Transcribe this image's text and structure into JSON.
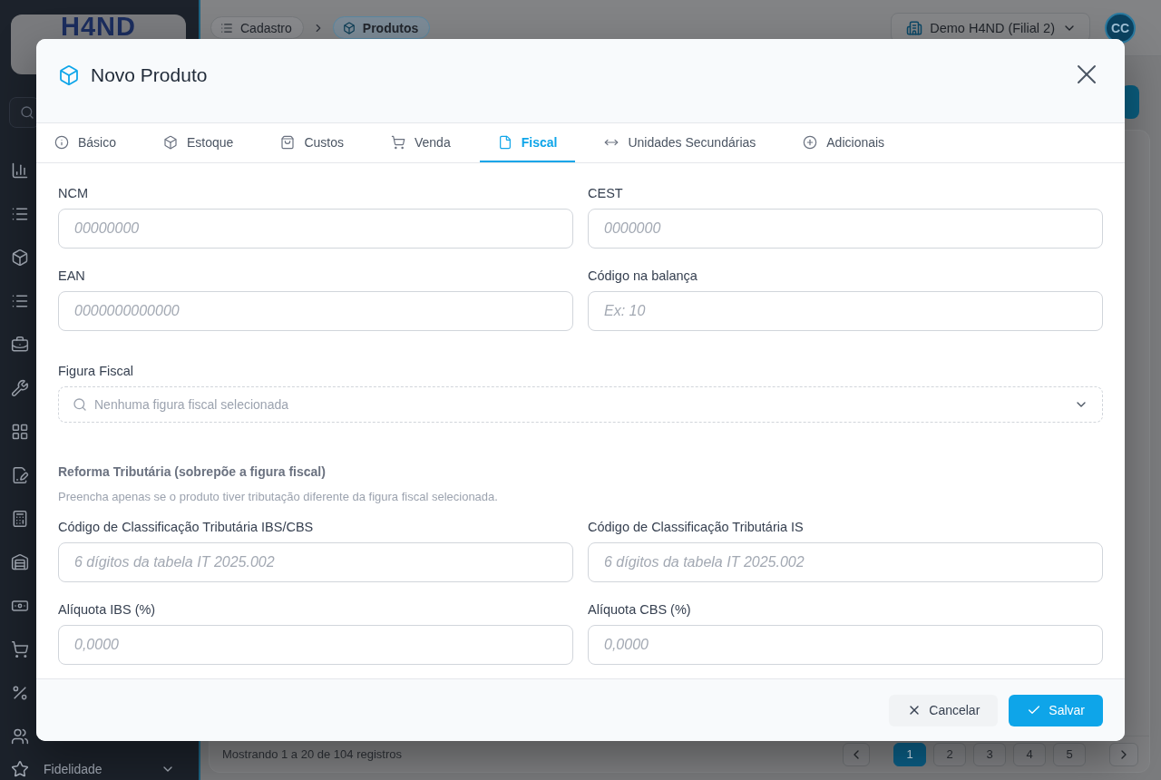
{
  "sidebar": {
    "logo": "H4ND",
    "footer_item": {
      "label": "Fidelidade"
    }
  },
  "topbar": {
    "breadcrumb": [
      {
        "label": "Cadastro",
        "selected": false
      },
      {
        "label": "Produtos",
        "selected": true
      }
    ],
    "company": "Demo H4ND (Filial 2)",
    "avatar": "CC"
  },
  "list": {
    "summary": "Mostrando 1 a 20 de 104 registros",
    "pages": [
      {
        "label": "1",
        "selected": true
      },
      {
        "label": "2",
        "selected": false
      },
      {
        "label": "3",
        "selected": false
      },
      {
        "label": "4",
        "selected": false
      },
      {
        "label": "5",
        "selected": false
      }
    ]
  },
  "modal": {
    "title": "Novo Produto",
    "tabs": [
      {
        "label": "Básico",
        "selected": false
      },
      {
        "label": "Estoque",
        "selected": false
      },
      {
        "label": "Custos",
        "selected": false
      },
      {
        "label": "Venda",
        "selected": false
      },
      {
        "label": "Fiscal",
        "selected": true
      },
      {
        "label": "Unidades Secundárias",
        "selected": false
      },
      {
        "label": "Adicionais",
        "selected": false
      }
    ],
    "fields": [
      {
        "label": "NCM",
        "placeholder": "00000000"
      },
      {
        "label": "CEST",
        "placeholder": "0000000"
      },
      {
        "label": "EAN",
        "placeholder": "0000000000000"
      },
      {
        "label": "Código na balança",
        "placeholder": "Ex: 10"
      }
    ],
    "fiscal_figure": {
      "label": "Figura Fiscal",
      "placeholder": "Nenhuma figura fiscal selecionada"
    },
    "tax_reform": {
      "title": "Reforma Tributária (sobrepõe a figura fiscal)",
      "description": "Preencha apenas se o produto tiver tributação diferente da figura fiscal selecionada.",
      "fields": [
        {
          "label": "Código de Classificação Tributária IBS/CBS",
          "placeholder": "6 dígitos da tabela IT 2025.002"
        },
        {
          "label": "Código de Classificação Tributária IS",
          "placeholder": "6 dígitos da tabela IT 2025.002"
        },
        {
          "label": "Alíquota IBS (%)",
          "placeholder": "0,0000"
        },
        {
          "label": "Alíquota CBS (%)",
          "placeholder": "0,0000"
        }
      ]
    },
    "buttons": [
      {
        "label": "Cancelar",
        "kind": "secondary"
      },
      {
        "label": "Salvar",
        "kind": "primary"
      }
    ]
  }
}
